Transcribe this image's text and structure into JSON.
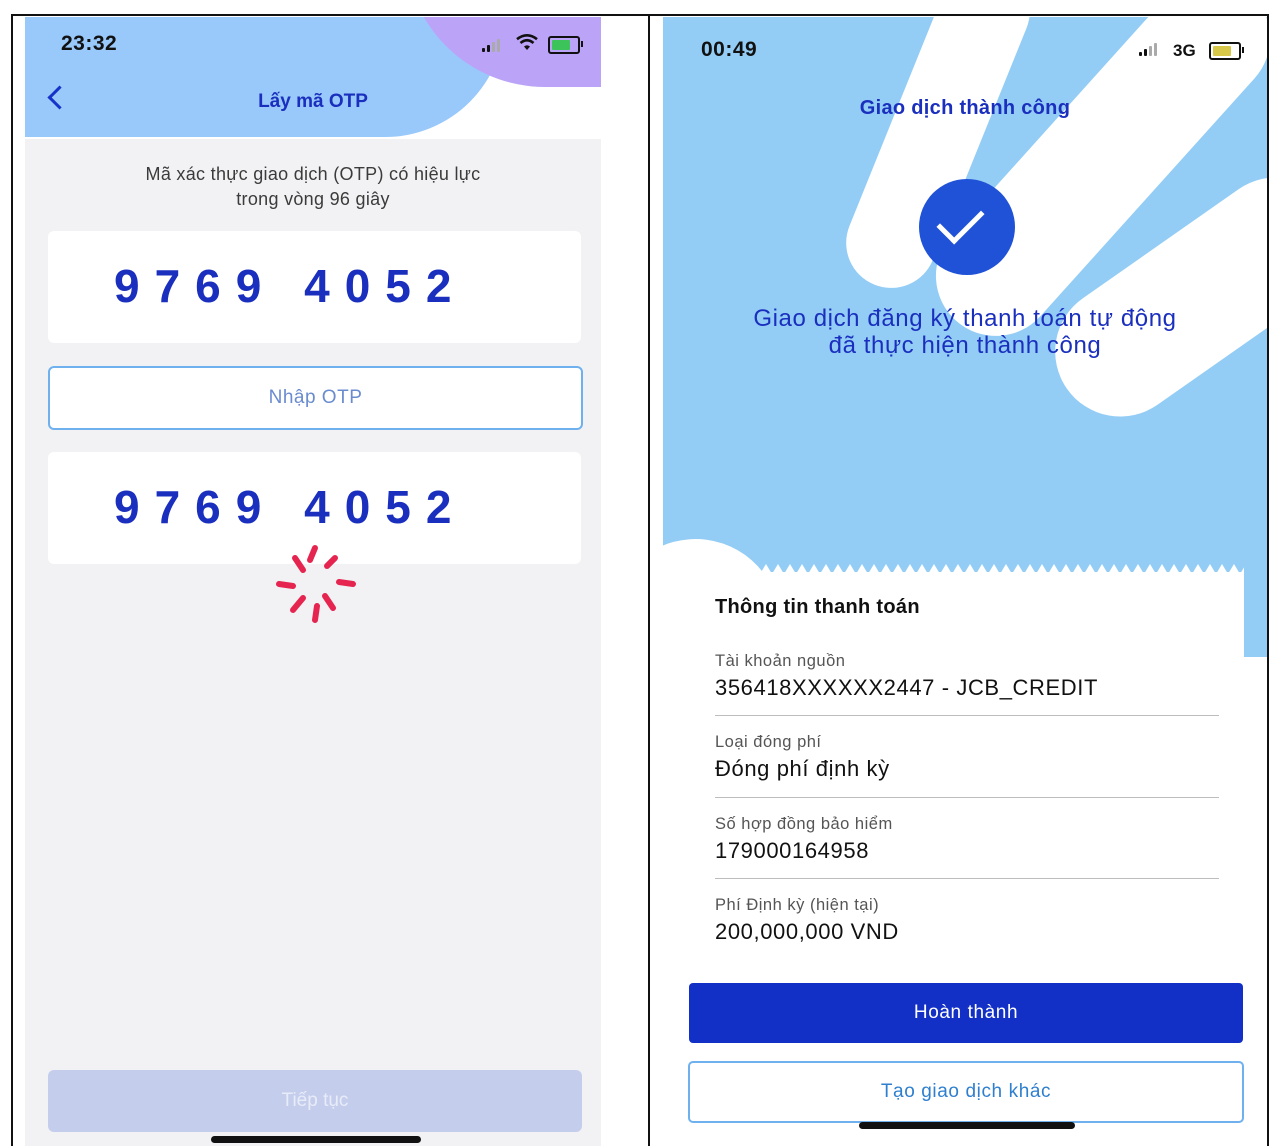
{
  "left_screen": {
    "status_bar": {
      "time": "23:32",
      "icons": [
        "signal-icon",
        "wifi-icon",
        "battery-charging-icon"
      ]
    },
    "header": {
      "title": "Lấy mã OTP",
      "back_icon": "chevron-left-icon"
    },
    "otp_info_line1": "Mã xác thực giao dịch (OTP) có hiệu lực",
    "otp_info_line2": "trong vòng 96 giây",
    "otp_code_top": "9769 4052",
    "otp_input": {
      "placeholder": "Nhập OTP"
    },
    "otp_code_bottom": "9769 4052",
    "loading_icon": "spinner-icon",
    "continue_button": "Tiếp tục"
  },
  "right_screen": {
    "status_bar": {
      "time": "00:49",
      "network": "3G",
      "icons": [
        "signal-icon",
        "battery-charging-icon"
      ]
    },
    "header": {
      "title": "Giao dịch thành công"
    },
    "success_icon": "checkmark-icon",
    "success_message_line1": "Giao dịch đăng ký thanh toán tự động",
    "success_message_line2": "đã thực hiện thành công",
    "payment_info": {
      "title": "Thông tin thanh toán",
      "fields": [
        {
          "label": "Tài khoản nguồn",
          "value": "356418XXXXXX2447 - JCB_CREDIT"
        },
        {
          "label": "Loại đóng phí",
          "value": "Đóng phí định kỳ"
        },
        {
          "label": "Số hợp đồng bảo hiểm",
          "value": "179000164958"
        },
        {
          "label": "Phí Định kỳ (hiện tại)",
          "value": "200,000,000 VND"
        }
      ]
    },
    "primary_button": "Hoàn thành",
    "secondary_button": "Tạo giao dịch khác"
  },
  "colors": {
    "brand_blue": "#1a2fbe",
    "button_blue": "#1230c5",
    "light_blue": "#93cdf6",
    "lavender": "#bba4f7",
    "spinner_red": "#e5254f"
  }
}
